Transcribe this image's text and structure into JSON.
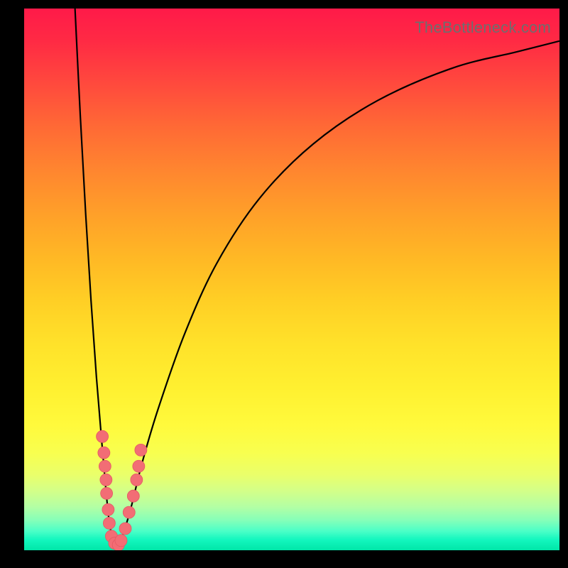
{
  "watermark": "TheBottleneck.com",
  "colors": {
    "curve": "#000000",
    "dot_fill": "#f26d75",
    "dot_stroke": "#e45a63"
  },
  "chart_data": {
    "type": "line",
    "title": "",
    "xlabel": "",
    "ylabel": "",
    "xlim": [
      0,
      100
    ],
    "ylim": [
      0,
      100
    ],
    "grid": false,
    "series": [
      {
        "name": "left_curve",
        "x": [
          9.5,
          10.5,
          11.5,
          12.5,
          13.5,
          14.5,
          15.2,
          15.8,
          16.4,
          17.0
        ],
        "values": [
          100,
          80,
          62,
          46,
          32,
          20,
          12,
          6,
          2.5,
          0.5
        ]
      },
      {
        "name": "right_curve",
        "x": [
          17.5,
          18.5,
          20,
          22,
          25,
          30,
          36,
          44,
          54,
          66,
          80,
          92,
          100
        ],
        "values": [
          0.5,
          3,
          8,
          16,
          26,
          40,
          53,
          65,
          75,
          83,
          89,
          92,
          94
        ]
      }
    ],
    "marker_cluster": {
      "name": "dots_near_minimum",
      "points": [
        {
          "x": 14.6,
          "y": 21
        },
        {
          "x": 14.9,
          "y": 18
        },
        {
          "x": 15.1,
          "y": 15.5
        },
        {
          "x": 15.3,
          "y": 13
        },
        {
          "x": 15.4,
          "y": 10.5
        },
        {
          "x": 15.7,
          "y": 7.5
        },
        {
          "x": 15.9,
          "y": 5
        },
        {
          "x": 16.3,
          "y": 2.6
        },
        {
          "x": 16.9,
          "y": 1.3
        },
        {
          "x": 17.6,
          "y": 1.0
        },
        {
          "x": 18.1,
          "y": 1.8
        },
        {
          "x": 18.9,
          "y": 4.0
        },
        {
          "x": 19.6,
          "y": 7.0
        },
        {
          "x": 20.4,
          "y": 10.0
        },
        {
          "x": 21.0,
          "y": 13.0
        },
        {
          "x": 21.4,
          "y": 15.5
        },
        {
          "x": 21.8,
          "y": 18.5
        }
      ]
    }
  }
}
